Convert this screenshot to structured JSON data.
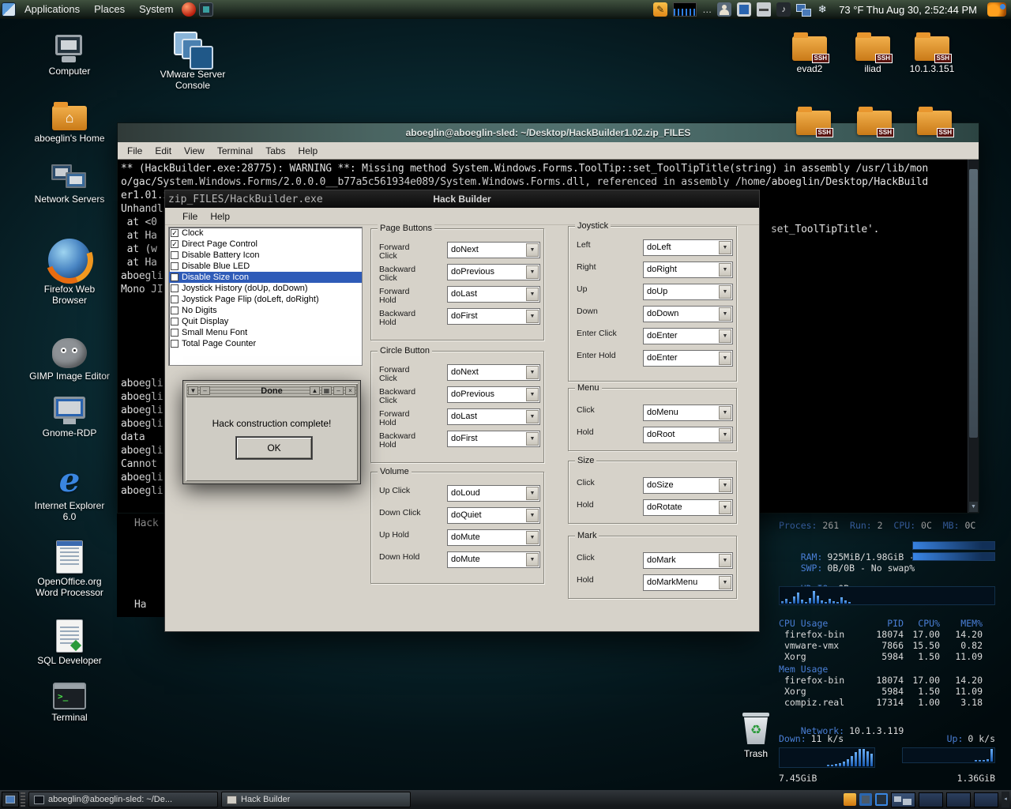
{
  "colors": {
    "selection_blue": "#2e5bb8",
    "conky_label_blue": "#4a7fd6",
    "graph_bar_blue": "#2f7fe0",
    "folder_orange": "#e8962e",
    "desktop_teal": "#14424a"
  },
  "icons": {
    "dropdown": "▼",
    "check": "✓",
    "house": "⌂",
    "recycle": "♻",
    "pencil": "✎",
    "note": "♪",
    "snow": "❄",
    "ellipsis": "…",
    "shade": "▼",
    "up": "▲",
    "grid": "▦",
    "minus": "–",
    "close": "×"
  },
  "top_panel": {
    "menus": [
      "Applications",
      "Places",
      "System"
    ],
    "clock": "73 °F Thu Aug 30, 2:52:44 PM"
  },
  "desktop": {
    "left_icons": [
      "Computer",
      "aboeglin's Home",
      "Network Servers",
      "Firefox Web Browser",
      "GIMP Image Editor",
      "Gnome-RDP",
      "Internet Explorer 6.0",
      "OpenOffice.org Word Processor",
      "SQL Developer",
      "Terminal"
    ],
    "vmware_label": "VMware Server Console",
    "ssh_labels": [
      "evad2",
      "iliad",
      "10.1.3.151"
    ],
    "trash_label": "Trash"
  },
  "terminal": {
    "title": "aboeglin@aboeglin-sled: ~/Desktop/HackBuilder1.02.zip_FILES",
    "menus": [
      "File",
      "Edit",
      "View",
      "Terminal",
      "Tabs",
      "Help"
    ],
    "lines": [
      "** (HackBuilder.exe:28775): WARNING **: Missing method System.Windows.Forms.ToolTip::set_ToolTipTitle(string) in assembly /usr/lib/mon",
      "o/gac/System.Windows.Forms/2.0.0.0__b77a5c561934e089/System.Windows.Forms.dll, referenced in assembly /home/aboeglin/Desktop/HackBuild",
      "er1.01.zip_FILES/HackBuilder.exe"
    ],
    "fragments_upper": [
      "Unhandl",
      " at <0",
      " at Ha",
      " at (w",
      " at Ha",
      "aboegli",
      "Mono JI"
    ],
    "fragments_lower": [
      "aboegli",
      "aboegli",
      "aboegli",
      "aboegli",
      "data",
      "aboegli",
      "Cannot",
      "aboegli",
      "aboegli"
    ],
    "fragment_right": "set_ToolTipTitle'.",
    "fragments_below": [
      "Hack",
      "Ha"
    ]
  },
  "hack_builder": {
    "title": "Hack Builder",
    "title_left_text": "zip_FILES/HackBuilder.exe",
    "menus": [
      "File",
      "Help"
    ],
    "checklist": [
      {
        "label": "Clock",
        "checked": true,
        "selected": false
      },
      {
        "label": "Direct Page Control",
        "checked": true,
        "selected": false
      },
      {
        "label": "Disable Battery Icon",
        "checked": false,
        "selected": false
      },
      {
        "label": "Disable Blue LED",
        "checked": false,
        "selected": false
      },
      {
        "label": "Disable Size Icon",
        "checked": false,
        "selected": true
      },
      {
        "label": "Joystick History (doUp, doDown)",
        "checked": false,
        "selected": false
      },
      {
        "label": "Joystick Page Flip (doLeft, doRight)",
        "checked": false,
        "selected": false
      },
      {
        "label": "No Digits",
        "checked": false,
        "selected": false
      },
      {
        "label": "Quit Display",
        "checked": false,
        "selected": false
      },
      {
        "label": "Small Menu Font",
        "checked": false,
        "selected": false
      },
      {
        "label": "Total Page Counter",
        "checked": false,
        "selected": false
      }
    ],
    "groups": [
      {
        "title": "Page Buttons",
        "rows": [
          {
            "label": "Forward Click",
            "value": "doNext"
          },
          {
            "label": "Backward Click",
            "value": "doPrevious"
          },
          {
            "label": "Forward Hold",
            "value": "doLast"
          },
          {
            "label": "Backward Hold",
            "value": "doFirst"
          }
        ]
      },
      {
        "title": "Circle Button",
        "rows": [
          {
            "label": "Forward Click",
            "value": "doNext"
          },
          {
            "label": "Backward Click",
            "value": "doPrevious"
          },
          {
            "label": "Forward Hold",
            "value": "doLast"
          },
          {
            "label": "Backward Hold",
            "value": "doFirst"
          }
        ]
      },
      {
        "title": "Volume",
        "rows": [
          {
            "label": "Up Click",
            "value": "doLoud"
          },
          {
            "label": "Down Click",
            "value": "doQuiet"
          },
          {
            "label": "Up Hold",
            "value": "doMute"
          },
          {
            "label": "Down Hold",
            "value": "doMute"
          }
        ]
      },
      {
        "title": "Joystick",
        "rows": [
          {
            "label": "Left",
            "value": "doLeft"
          },
          {
            "label": "Right",
            "value": "doRight"
          },
          {
            "label": "Up",
            "value": "doUp"
          },
          {
            "label": "Down",
            "value": "doDown"
          },
          {
            "label": "Enter Click",
            "value": "doEnter"
          },
          {
            "label": "Enter Hold",
            "value": "doEnter"
          }
        ]
      },
      {
        "title": "Menu",
        "rows": [
          {
            "label": "Click",
            "value": "doMenu"
          },
          {
            "label": "Hold",
            "value": "doRoot"
          }
        ]
      },
      {
        "title": "Size",
        "rows": [
          {
            "label": "Click",
            "value": "doSize"
          },
          {
            "label": "Hold",
            "value": "doRotate"
          }
        ]
      },
      {
        "title": "Mark",
        "rows": [
          {
            "label": "Click",
            "value": "doMark"
          },
          {
            "label": "Hold",
            "value": "doMarkMenu"
          }
        ]
      }
    ]
  },
  "done_dialog": {
    "title": "Done",
    "message": "Hack construction complete!",
    "ok": "OK"
  },
  "system_monitor": {
    "header_segments": [
      [
        "Proces:",
        "261"
      ],
      [
        "Run:",
        "2"
      ],
      [
        "CPU:",
        "0C"
      ],
      [
        "MB:",
        "0C"
      ]
    ],
    "ram_label": "RAM:",
    "ram_value": "925MiB/1.98GiB - 45%",
    "swap_label": "SWP:",
    "swap_value": "0B/0B - No swap%",
    "hdio_label": "HD IO:",
    "hdio_value": "0B",
    "cpu_table": {
      "header": [
        "CPU Usage",
        "PID",
        "CPU%",
        "MEM%"
      ],
      "rows": [
        [
          "firefox-bin",
          "18074",
          "17.00",
          "14.20"
        ],
        [
          "vmware-vmx",
          "7866",
          "15.50",
          "0.82"
        ],
        [
          "Xorg",
          "5984",
          "1.50",
          "11.09"
        ]
      ]
    },
    "mem_table": {
      "header": "Mem Usage",
      "rows": [
        [
          "firefox-bin",
          "18074",
          "17.00",
          "14.20"
        ],
        [
          "Xorg",
          "5984",
          "1.50",
          "11.09"
        ],
        [
          "compiz.real",
          "17314",
          "1.00",
          "3.18"
        ]
      ]
    },
    "network_label": "Network:",
    "network_value": "10.1.3.119",
    "down_label": "Down:",
    "down_value": "11 k/s",
    "up_label": "Up:",
    "up_value": "0 k/s",
    "down_total": "7.45GiB",
    "up_total": "1.36GiB"
  },
  "taskbar": {
    "tasks": [
      "aboeglin@aboeglin-sled: ~/De...",
      "Hack Builder"
    ]
  }
}
